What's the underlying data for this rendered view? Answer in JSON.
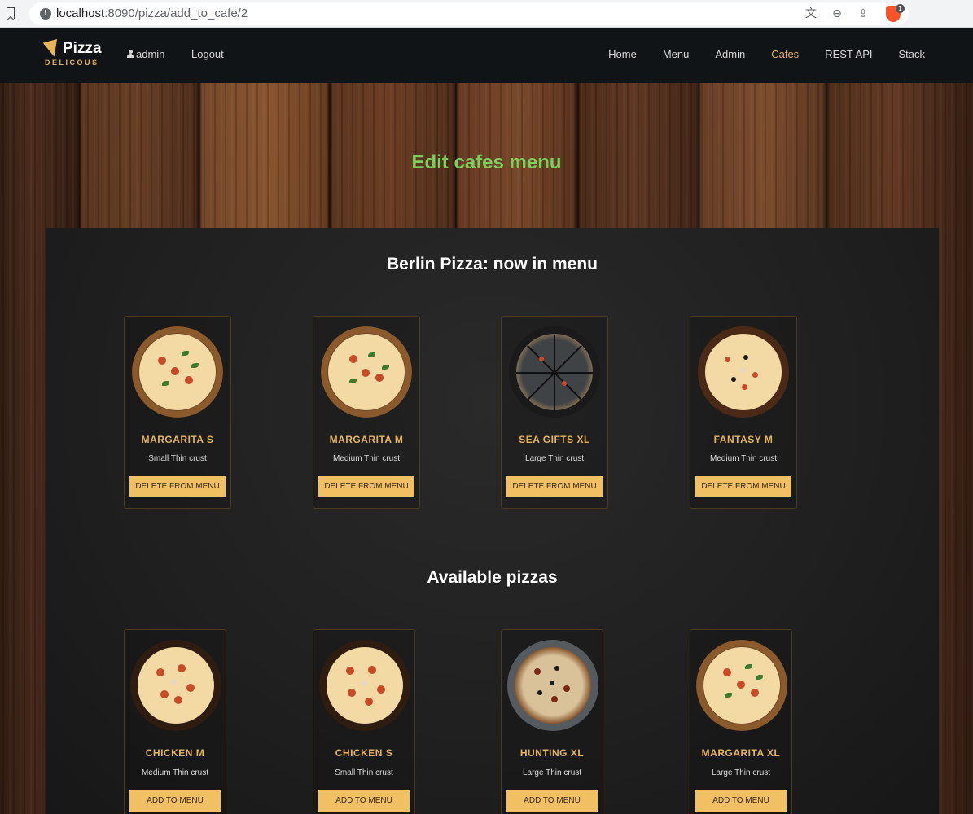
{
  "browser": {
    "url_host": "localhost",
    "url_rest": ":8090/pizza/add_to_cafe/2",
    "extension_badge": "1"
  },
  "navbar": {
    "logo_title": "Pizza",
    "logo_subtitle": "DELICOUS",
    "user": "admin",
    "logout": "Logout",
    "menu": [
      "Home",
      "Menu",
      "Admin",
      "Cafes",
      "REST API",
      "Stack"
    ],
    "active_item": "Cafes"
  },
  "page": {
    "heading": "Edit cafes menu",
    "menu_section_title": "Berlin Pizza: now in menu",
    "available_section_title": "Available pizzas"
  },
  "in_menu": [
    {
      "name": "MARGARITA S",
      "desc": "Small Thin crust",
      "button": "DELETE FROM MENU"
    },
    {
      "name": "MARGARITA M",
      "desc": "Medium Thin crust",
      "button": "DELETE FROM MENU"
    },
    {
      "name": "SEA GIFTS XL",
      "desc": "Large Thin crust",
      "button": "DELETE FROM MENU"
    },
    {
      "name": "FANTASY M",
      "desc": "Medium Thin crust",
      "button": "DELETE FROM MENU"
    }
  ],
  "available": [
    {
      "name": "CHICKEN M",
      "desc": "Medium Thin crust",
      "button": "ADD TO MENU"
    },
    {
      "name": "CHICKEN S",
      "desc": "Small Thin crust",
      "button": "ADD TO MENU"
    },
    {
      "name": "HUNTING XL",
      "desc": "Large Thin crust",
      "button": "ADD TO MENU"
    },
    {
      "name": "MARGARITA XL",
      "desc": "Large Thin crust",
      "button": "ADD TO MENU"
    }
  ],
  "colors": {
    "accent": "#e7b556",
    "heading_green": "#7ccf5a",
    "button": "#f0c062",
    "navbar": "#111416"
  }
}
